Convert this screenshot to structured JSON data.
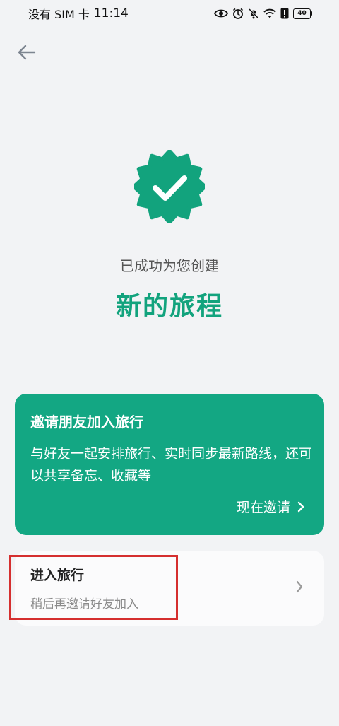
{
  "status_bar": {
    "carrier": "没有 SIM 卡",
    "time": "11:14",
    "battery": "40",
    "icons": [
      "eye-icon",
      "alarm-icon",
      "mute-icon",
      "wifi-icon",
      "alert-icon",
      "battery-icon"
    ]
  },
  "nav": {
    "back_icon": "arrow-left-icon"
  },
  "success": {
    "icon": "verified-badge-icon",
    "subtitle": "已成功为您创建",
    "title": "新的旅程",
    "accent": "#12a37d"
  },
  "invite_card": {
    "title": "邀请朋友加入旅行",
    "description": "与好友一起安排旅行、实时同步最新路线，还可以共享备忘、收藏等",
    "action_label": "现在邀请",
    "background": "#13a783"
  },
  "enter_card": {
    "title": "进入旅行",
    "subtitle": "稍后再邀请好友加入"
  }
}
